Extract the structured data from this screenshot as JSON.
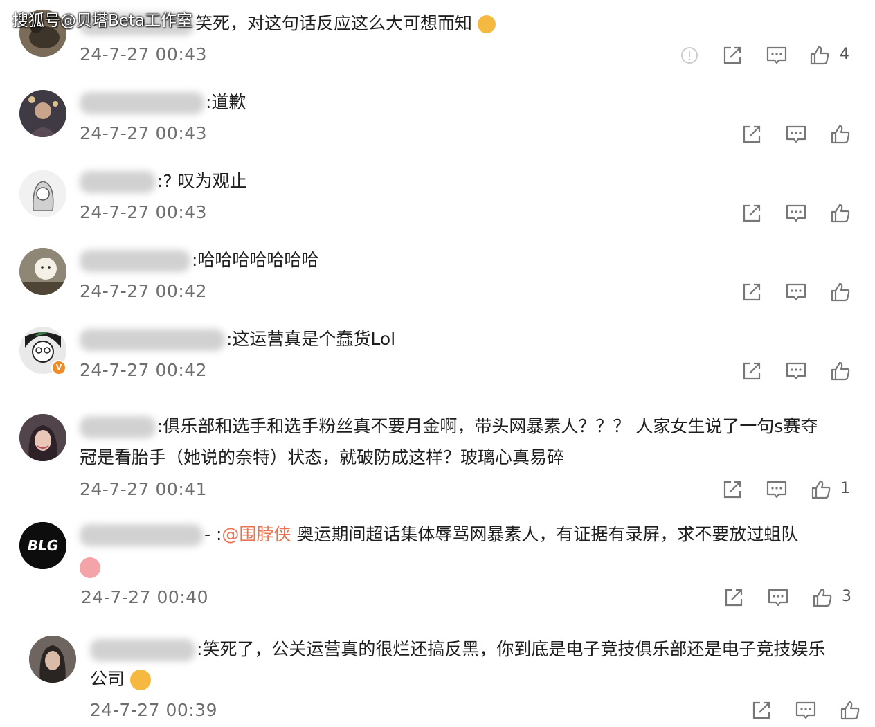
{
  "watermark": "搜狐号@贝塔Beta工作室",
  "comments": [
    {
      "text": "笑死，对这句话反应这么大可想而知",
      "time": "24-7-27 00:43",
      "likes": "4"
    },
    {
      "text": ":道歉",
      "time": "24-7-27 00:43",
      "likes": ""
    },
    {
      "text": ":? 叹为观止",
      "time": "24-7-27 00:43",
      "likes": ""
    },
    {
      "text": ":哈哈哈哈哈哈哈",
      "time": "24-7-27 00:42",
      "likes": ""
    },
    {
      "text": ":这运营真是个蠢货Lol",
      "time": "24-7-27 00:42",
      "likes": ""
    },
    {
      "text_line1": ":俱乐部和选手和选手粉丝真不要月金啊，带头网暴素人？？？ 人家女生说了一句s赛夺",
      "text_line2": "冠是看胎手（她说的奈特）状态，就破防成这样？玻璃心真易碎",
      "time": "24-7-27 00:41",
      "likes": "1"
    },
    {
      "prefix": "- :",
      "mention": "@围脖侠",
      "text_line1": " 奥运期间超话集体辱骂网暴素人，有证据有录屏，求不要放过蛆队",
      "time": "24-7-27 00:40",
      "likes": "3"
    },
    {
      "text_line1": ":笑死了，公关运营真的很烂还搞反黑，你到底是电子竞技俱乐部还是电子竞技娱乐",
      "text_line2": "公司",
      "time": "24-7-27 00:39",
      "likes": ""
    }
  ],
  "colors": {
    "mention": "#eb7350",
    "time": "#6e6e6e",
    "icon": "#777777"
  },
  "icons": [
    "report-icon",
    "share-icon",
    "comment-icon",
    "like-icon"
  ]
}
